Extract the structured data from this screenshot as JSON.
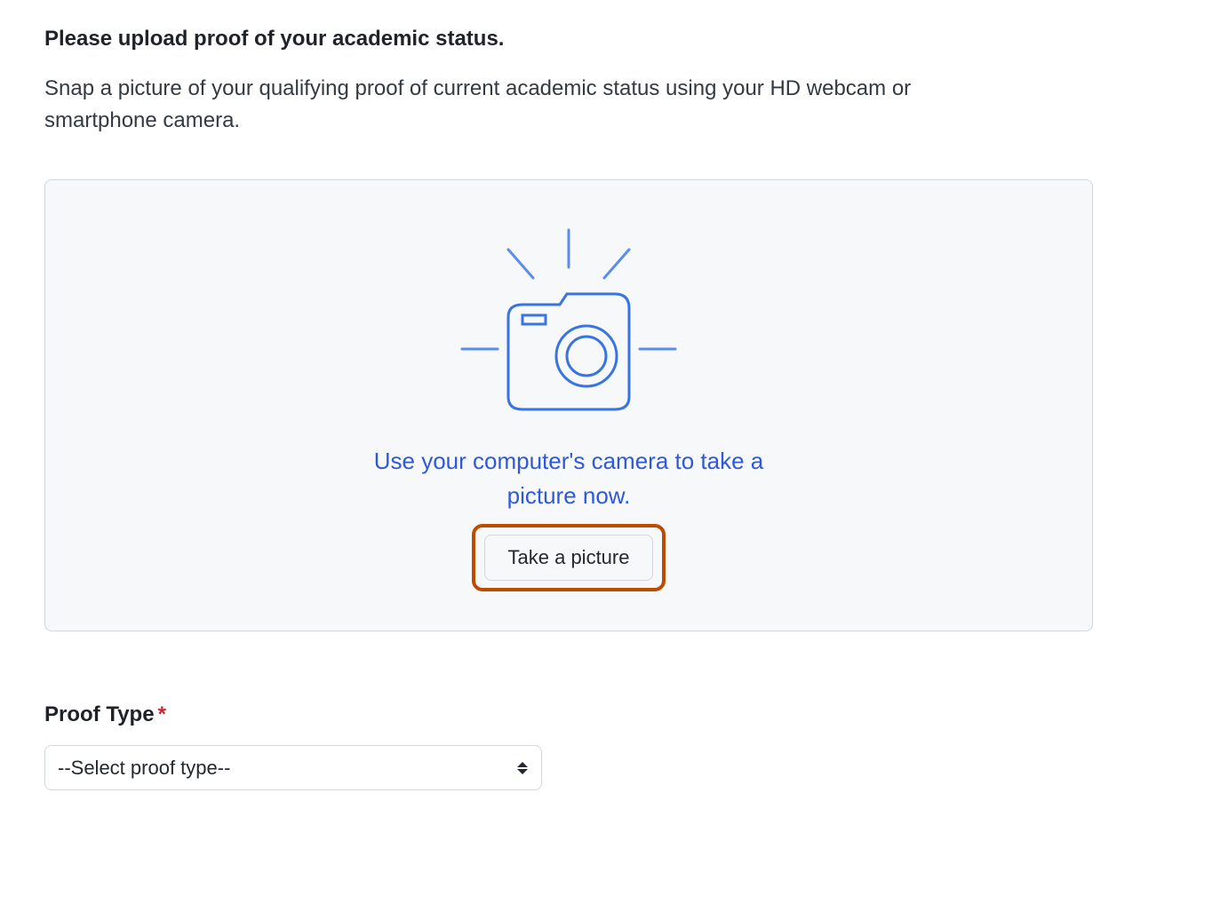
{
  "heading": "Please upload proof of your academic status.",
  "description": "Snap a picture of your qualifying proof of current academic status using your HD webcam or smartphone camera.",
  "upload_panel": {
    "camera_prompt": "Use your computer's camera to take a picture now.",
    "take_picture_label": "Take a picture"
  },
  "proof_type": {
    "label": "Proof Type",
    "required_mark": "*",
    "selected": "--Select proof type--"
  },
  "colors": {
    "accent_blue": "#2f59d8",
    "highlight_orange": "#bc4c00",
    "panel_bg": "#f6f8fa",
    "border": "#d0d7de",
    "text": "#24292f",
    "required": "#cf222e"
  }
}
